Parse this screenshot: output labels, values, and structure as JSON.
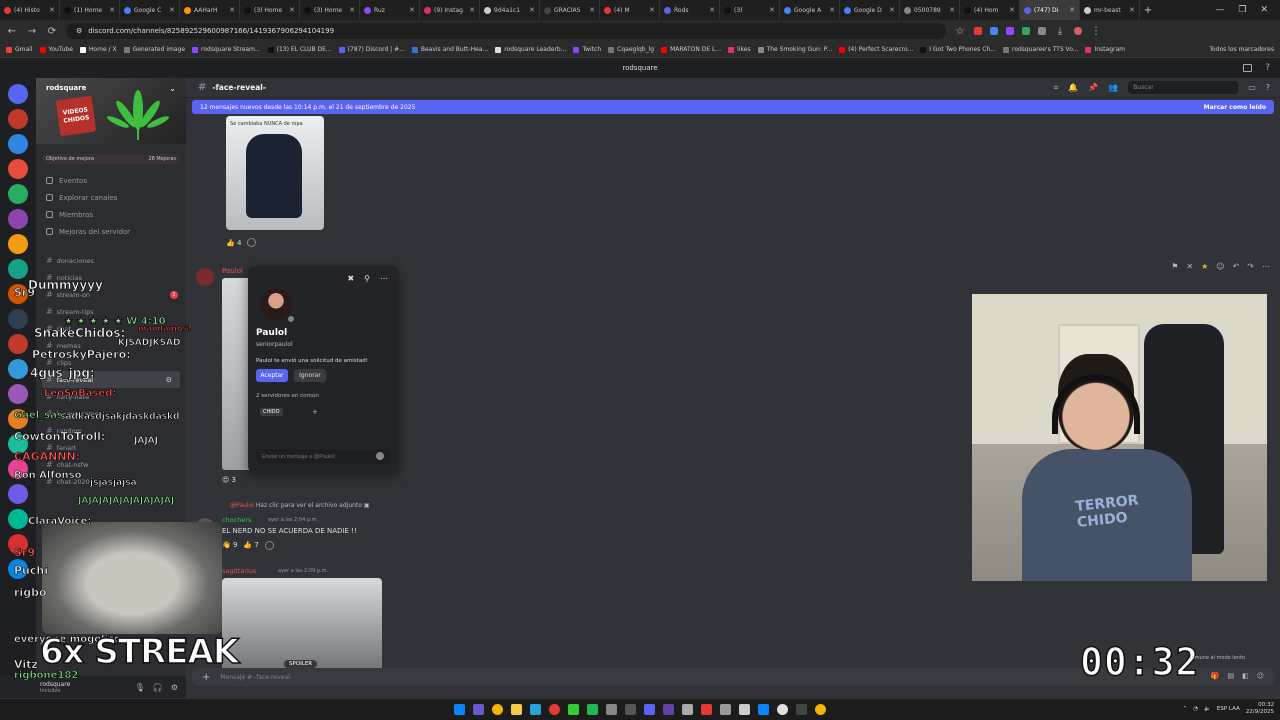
{
  "browser": {
    "tabs": [
      {
        "label": "(4) Histo",
        "color": "#e53935"
      },
      {
        "label": "(1) Home",
        "color": "#111111"
      },
      {
        "label": "Google C",
        "color": "#4285f4"
      },
      {
        "label": "AAHarH",
        "color": "#ff9800"
      },
      {
        "label": "(3) Home",
        "color": "#111111"
      },
      {
        "label": "(3) Home",
        "color": "#111111"
      },
      {
        "label": "Ruz",
        "color": "#9146ff"
      },
      {
        "label": "(9) Instag",
        "color": "#e1306c"
      },
      {
        "label": "9d4a1c1",
        "color": "#cccccc"
      },
      {
        "label": "GRACIAS",
        "color": "#444444"
      },
      {
        "label": "(4) M",
        "color": "#e53935"
      },
      {
        "label": "Rods",
        "color": "#5865f2"
      },
      {
        "label": "(3)",
        "color": "#111111"
      },
      {
        "label": "Google A",
        "color": "#4285f4"
      },
      {
        "label": "Google D",
        "color": "#4285f4"
      },
      {
        "label": "0500789",
        "color": "#888888"
      },
      {
        "label": "(4) Hom",
        "color": "#111111"
      },
      {
        "label": "(747) Di",
        "color": "#5865f2",
        "active": true
      },
      {
        "label": "mr-beast",
        "color": "#cccccc"
      }
    ],
    "url": "discord.com/channels/825892529600987166/1419367906294104199",
    "bookmarks": [
      {
        "label": "Gmail",
        "color": "#ea4335"
      },
      {
        "label": "YouTube",
        "color": "#ff0000"
      },
      {
        "label": "Home / X",
        "color": "#ffffff"
      },
      {
        "label": "Generated image",
        "color": "#777777"
      },
      {
        "label": "rodsquare Stream...",
        "color": "#9146ff"
      },
      {
        "label": "(13) EL CLUB DE...",
        "color": "#111111"
      },
      {
        "label": "(787) Discord | #...",
        "color": "#5865f2"
      },
      {
        "label": "Beavis and Butt-Hea...",
        "color": "#3b6fd4"
      },
      {
        "label": "rodsquare Leaderb...",
        "color": "#dddddd"
      },
      {
        "label": "Twitch",
        "color": "#9146ff"
      },
      {
        "label": "Cqaeglqb_lg",
        "color": "#777777"
      },
      {
        "label": "MARATON DE L...",
        "color": "#ff0000"
      },
      {
        "label": "likes",
        "color": "#e1306c"
      },
      {
        "label": "The Smoking Gun: P...",
        "color": "#888888"
      },
      {
        "label": "(4) Perfect Scarecro...",
        "color": "#ff0000"
      },
      {
        "label": "I Got Two Phones Ch...",
        "color": "#111111"
      },
      {
        "label": "rodsquaree's TTS Vo...",
        "color": "#777777"
      },
      {
        "label": "Instagram",
        "color": "#e1306c"
      }
    ],
    "all_bookmarks": "Todos los marcadores"
  },
  "discord": {
    "window_title": "rodsquare",
    "server": {
      "name": "rodsquare",
      "banner_logo": "VIDEOS CHIDOS",
      "boost_goal": "Objetivo de mejora",
      "boost_count": "28 Mejoras"
    },
    "sidebar_items": [
      {
        "label": "Eventos"
      },
      {
        "label": "Explorar canales"
      },
      {
        "label": "Miembros"
      },
      {
        "label": "Mejoras del servidor"
      }
    ],
    "channels": [
      {
        "label": "donaciones"
      },
      {
        "label": "noticias"
      },
      {
        "label": "stream-on",
        "badge": "1"
      },
      {
        "label": "stream-tips"
      },
      {
        "label": "chat"
      },
      {
        "label": "memes"
      },
      {
        "label": "clips"
      },
      {
        "label": "face-reveal",
        "active": true
      },
      {
        "label": "furry-hate"
      },
      {
        "label": "lenovo-como"
      },
      {
        "label": "random"
      },
      {
        "label": "fanart"
      },
      {
        "label": "chat-nsfw"
      },
      {
        "label": "chat-2020"
      }
    ],
    "user": {
      "name": "rodsquare",
      "status": "Invisible"
    },
    "channel_title": "-face-reveal-",
    "search_placeholder": "Buscar",
    "new_messages": "12 mensajes nuevos desde las 10:14 p.m. el 21 de septiembre de 2025",
    "mark_read": "Marcar como leído",
    "messages": [
      {
        "caption": "Se cambiaba NUNCA de ropa",
        "reaction_count": "4"
      },
      {
        "author": "Paulol",
        "reaction_count": "3"
      },
      {
        "reply_author": "@Paulol",
        "reply_text": "Haz clic para ver el archivo adjunto",
        "author": "chochers",
        "time": "ayer a las 2:04 p.m.",
        "text": "EL NERD NO SE ACUERDA DE NADIE !!",
        "reactions": [
          "9",
          "7"
        ]
      },
      {
        "author": "sagittarius",
        "time": "ayer a las 2:09 p.m.",
        "spoiler_label": "SPOILER"
      }
    ],
    "composer_placeholder": "Mensaje # -face-reveal-",
    "profile": {
      "name": "Paulol",
      "username": "seniorpaulol",
      "request_text": "Paulol te envió una solicitud de amistad!",
      "accept_label": "Aceptar",
      "ignore_label": "Ignorar",
      "mutual": "2 servidores en común",
      "tag": "CHIDO",
      "message_placeholder": "Enviar un mensaje a @Paulol"
    }
  },
  "overlay": {
    "chat_lines": [
      "Sr9",
      "Dummyyyy",
      "★ ★ ★ ★ ★ W 4:10",
      "mandamos?",
      "SnakeChidos:",
      "KJSADJKSAD",
      "PetroskyPajero:",
      "4gus_jpg:",
      "LeoSoBased:",
      "Gael_sas:",
      "sadkasdjsakjdaskdaskd",
      "CowtonToTroll:",
      "JAJAJ",
      "CAGANNN:",
      "Ron Alfonso",
      "jsjasjajsa",
      "JAJAJAJAJAJAJAJAJAJ",
      "ClaraVoice:",
      "Sr9",
      "Puchi",
      "rigbo",
      "everyone mogolico",
      "Vitz",
      "rigbone182"
    ],
    "streak": "6x STREAK",
    "timer": "00:32",
    "slow_mode": "Inmune al modo lento",
    "shirt_text": "TERROR CHIDO"
  },
  "taskbar": {
    "lang": "ESP LAA",
    "time": "00:32",
    "date": "22/9/2025"
  }
}
